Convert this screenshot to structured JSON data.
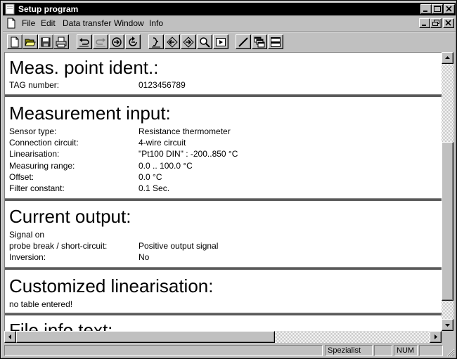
{
  "window": {
    "title": "Setup program"
  },
  "menu": {
    "items": [
      {
        "label": "File"
      },
      {
        "label": "Edit"
      },
      {
        "label": "Data transfer"
      },
      {
        "label": "Window"
      },
      {
        "label": "Info"
      }
    ]
  },
  "toolbar": {
    "buttons": [
      {
        "icon": "new-file-icon"
      },
      {
        "icon": "open-folder-icon"
      },
      {
        "icon": "save-disk-icon"
      },
      {
        "icon": "print-icon"
      },
      {
        "icon": "undo-icon"
      },
      {
        "icon": "redo-icon"
      },
      {
        "icon": "transfer-to-device-icon"
      },
      {
        "icon": "transfer-from-device-icon"
      },
      {
        "icon": "edit-settings-icon"
      },
      {
        "icon": "nav-left-icon"
      },
      {
        "icon": "nav-right-icon"
      },
      {
        "icon": "zoom-icon"
      },
      {
        "icon": "play-icon"
      },
      {
        "icon": "draw-line-icon"
      },
      {
        "icon": "cascade-windows-icon"
      },
      {
        "icon": "tile-windows-icon"
      }
    ]
  },
  "content": {
    "sections": [
      {
        "title": "Meas. point ident.:",
        "rows": [
          {
            "label": "TAG number:",
            "value": "0123456789"
          }
        ]
      },
      {
        "title": "Measurement input:",
        "rows": [
          {
            "label": "Sensor type:",
            "value": "Resistance thermometer"
          },
          {
            "label": "Connection circuit:",
            "value": "4-wire circuit"
          },
          {
            "label": "Linearisation:",
            "value": "\"Pt100 DIN\" : -200..850 °C"
          },
          {
            "label": "Measuring range:",
            "value": "0.0 .. 100.0 °C"
          },
          {
            "label": "Offset:",
            "value": "0.0 °C"
          },
          {
            "label": "Filter constant:",
            "value": "0.1 Sec."
          }
        ]
      },
      {
        "title": "Current output:",
        "rows": [
          {
            "label": "Signal on",
            "value": ""
          },
          {
            "label": "probe break / short-circuit:",
            "value": "Positive output signal"
          },
          {
            "label": "Inversion:",
            "value": "No"
          }
        ]
      },
      {
        "title": "Customized linearisation:",
        "rows": [
          {
            "label": "no table entered!",
            "value": ""
          }
        ]
      },
      {
        "title": "File info text:",
        "rows": []
      }
    ]
  },
  "statusbar": {
    "panels": [
      "",
      "Spezialist",
      "",
      "NUM",
      ""
    ]
  }
}
